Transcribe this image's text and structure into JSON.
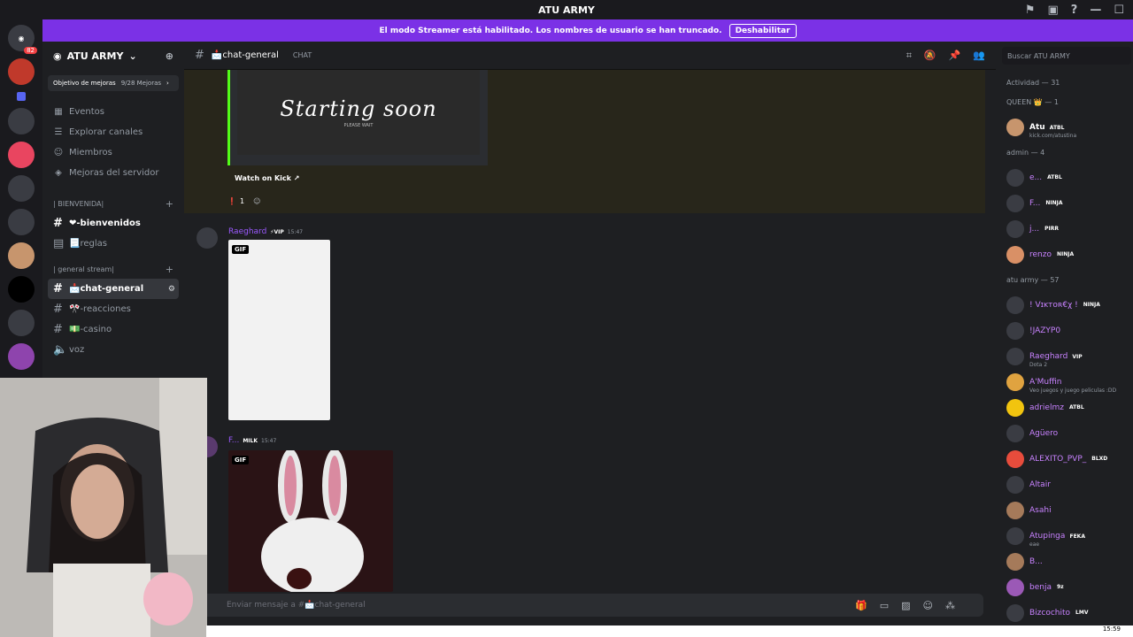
{
  "window": {
    "title": "ATU ARMY"
  },
  "banner": {
    "text": "El modo Streamer está habilitado. Los nombres de usuario se han truncado.",
    "button": "Deshabilitar"
  },
  "server": {
    "name": "ATU ARMY",
    "boost_label": "Objetivo de mejoras",
    "boost_progress": "9/28 Mejoras"
  },
  "nav": [
    "Eventos",
    "Explorar canales",
    "Miembros",
    "Mejoras del servidor"
  ],
  "categories": [
    {
      "name": "| BIENVENIDA|",
      "channels": [
        "❤-bienvenidos",
        "📃reglas"
      ]
    },
    {
      "name": "| general stream|",
      "channels": [
        "📩chat-general",
        "🎌-reacciones",
        "💵-casino",
        "voz"
      ]
    }
  ],
  "channel": {
    "name": "📩chat-general",
    "topic": "CHAT"
  },
  "messages": {
    "embed_link": "Watch on Kick",
    "kick_logo": "Starting soon",
    "kick_wait": "PLEASE WAIT",
    "reaction_count": "1",
    "msg1": {
      "user": "Raeghard",
      "badge": "⚡VIP",
      "time": "15:47",
      "gif": "GIF"
    },
    "msg2": {
      "user": "F...",
      "badge": "MILK",
      "time": "15:47",
      "gif": "GIF"
    }
  },
  "composer": {
    "placeholder": "Enviar mensaje a #📩chat-general"
  },
  "members": {
    "search_placeholder": "Buscar ATU ARMY",
    "activity": "Actividad — 31",
    "groups": [
      {
        "name": "QUEEN 👑 — 1",
        "items": [
          {
            "name": "Atu",
            "tag": "ATBL",
            "sub": "kick.com/atustina"
          }
        ]
      },
      {
        "name": "admin — 4",
        "items": [
          {
            "name": "e...",
            "tag": "ATBL",
            "sub": ""
          },
          {
            "name": "F...",
            "tag": "NINJA",
            "sub": ""
          },
          {
            "name": "j...",
            "tag": "PIRR",
            "sub": ""
          },
          {
            "name": "renzo",
            "tag": "NINJA",
            "sub": ""
          }
        ]
      },
      {
        "name": "atu army — 57",
        "items": [
          {
            "name": "! Vɪᴋᴛᴏʀ€χ !",
            "tag": "NINJA",
            "sub": ""
          },
          {
            "name": "!JAZYP0",
            "tag": "",
            "sub": ""
          },
          {
            "name": "Raeghard",
            "tag": "VIP",
            "sub": "Dota 2"
          },
          {
            "name": "A'Muffin",
            "tag": "",
            "sub": "Veo juegos y juego peliculas :DD"
          },
          {
            "name": "adrielmz",
            "tag": "ATBL",
            "sub": ""
          },
          {
            "name": "Agüero",
            "tag": "",
            "sub": ""
          },
          {
            "name": "ALEXITO_PVP_",
            "tag": "BLXD",
            "sub": ""
          },
          {
            "name": "Altair",
            "tag": "",
            "sub": ""
          },
          {
            "name": "Asahi",
            "tag": "",
            "sub": ""
          },
          {
            "name": "Atupinga",
            "tag": "FEKA",
            "sub": "eae"
          },
          {
            "name": "B...",
            "tag": "",
            "sub": ""
          },
          {
            "name": "benja",
            "tag": "9z",
            "sub": ""
          },
          {
            "name": "Bizcochito",
            "tag": "LMV",
            "sub": ""
          }
        ]
      }
    ]
  },
  "taskbar": {
    "time": "15:59"
  },
  "colors": {
    "accent": "#7b31e6",
    "kick_green": "#53fc18",
    "member_name": "#c882ff"
  }
}
